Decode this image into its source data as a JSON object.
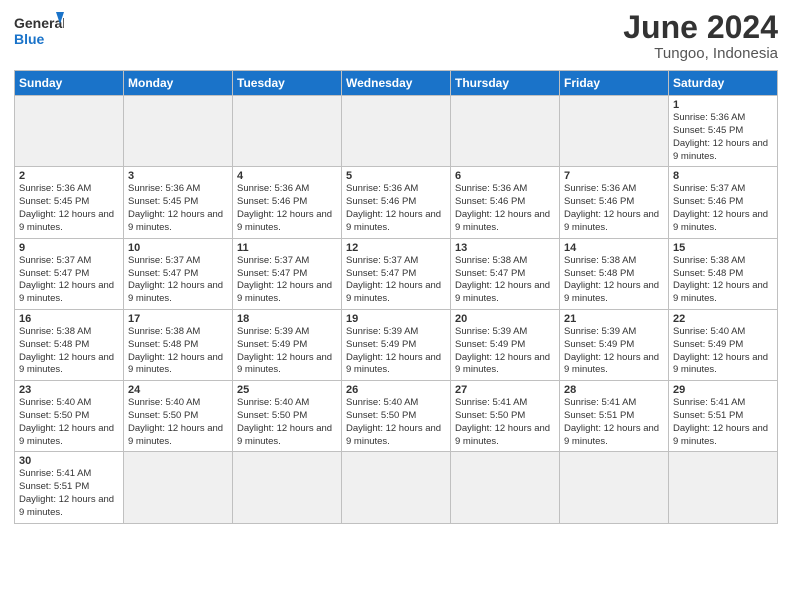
{
  "header": {
    "logo_general": "General",
    "logo_blue": "Blue",
    "title": "June 2024",
    "subtitle": "Tungoo, Indonesia"
  },
  "days_of_week": [
    "Sunday",
    "Monday",
    "Tuesday",
    "Wednesday",
    "Thursday",
    "Friday",
    "Saturday"
  ],
  "weeks": [
    [
      {
        "day": "",
        "info": "",
        "empty": true
      },
      {
        "day": "",
        "info": "",
        "empty": true
      },
      {
        "day": "",
        "info": "",
        "empty": true
      },
      {
        "day": "",
        "info": "",
        "empty": true
      },
      {
        "day": "",
        "info": "",
        "empty": true
      },
      {
        "day": "",
        "info": "",
        "empty": true
      },
      {
        "day": "1",
        "info": "Sunrise: 5:36 AM\nSunset: 5:45 PM\nDaylight: 12 hours and 9 minutes."
      }
    ],
    [
      {
        "day": "2",
        "info": "Sunrise: 5:36 AM\nSunset: 5:45 PM\nDaylight: 12 hours and 9 minutes."
      },
      {
        "day": "3",
        "info": "Sunrise: 5:36 AM\nSunset: 5:45 PM\nDaylight: 12 hours and 9 minutes."
      },
      {
        "day": "4",
        "info": "Sunrise: 5:36 AM\nSunset: 5:46 PM\nDaylight: 12 hours and 9 minutes."
      },
      {
        "day": "5",
        "info": "Sunrise: 5:36 AM\nSunset: 5:46 PM\nDaylight: 12 hours and 9 minutes."
      },
      {
        "day": "6",
        "info": "Sunrise: 5:36 AM\nSunset: 5:46 PM\nDaylight: 12 hours and 9 minutes."
      },
      {
        "day": "7",
        "info": "Sunrise: 5:36 AM\nSunset: 5:46 PM\nDaylight: 12 hours and 9 minutes."
      },
      {
        "day": "8",
        "info": "Sunrise: 5:37 AM\nSunset: 5:46 PM\nDaylight: 12 hours and 9 minutes."
      }
    ],
    [
      {
        "day": "9",
        "info": "Sunrise: 5:37 AM\nSunset: 5:47 PM\nDaylight: 12 hours and 9 minutes."
      },
      {
        "day": "10",
        "info": "Sunrise: 5:37 AM\nSunset: 5:47 PM\nDaylight: 12 hours and 9 minutes."
      },
      {
        "day": "11",
        "info": "Sunrise: 5:37 AM\nSunset: 5:47 PM\nDaylight: 12 hours and 9 minutes."
      },
      {
        "day": "12",
        "info": "Sunrise: 5:37 AM\nSunset: 5:47 PM\nDaylight: 12 hours and 9 minutes."
      },
      {
        "day": "13",
        "info": "Sunrise: 5:38 AM\nSunset: 5:47 PM\nDaylight: 12 hours and 9 minutes."
      },
      {
        "day": "14",
        "info": "Sunrise: 5:38 AM\nSunset: 5:48 PM\nDaylight: 12 hours and 9 minutes."
      },
      {
        "day": "15",
        "info": "Sunrise: 5:38 AM\nSunset: 5:48 PM\nDaylight: 12 hours and 9 minutes."
      }
    ],
    [
      {
        "day": "16",
        "info": "Sunrise: 5:38 AM\nSunset: 5:48 PM\nDaylight: 12 hours and 9 minutes."
      },
      {
        "day": "17",
        "info": "Sunrise: 5:38 AM\nSunset: 5:48 PM\nDaylight: 12 hours and 9 minutes."
      },
      {
        "day": "18",
        "info": "Sunrise: 5:39 AM\nSunset: 5:49 PM\nDaylight: 12 hours and 9 minutes."
      },
      {
        "day": "19",
        "info": "Sunrise: 5:39 AM\nSunset: 5:49 PM\nDaylight: 12 hours and 9 minutes."
      },
      {
        "day": "20",
        "info": "Sunrise: 5:39 AM\nSunset: 5:49 PM\nDaylight: 12 hours and 9 minutes."
      },
      {
        "day": "21",
        "info": "Sunrise: 5:39 AM\nSunset: 5:49 PM\nDaylight: 12 hours and 9 minutes."
      },
      {
        "day": "22",
        "info": "Sunrise: 5:40 AM\nSunset: 5:49 PM\nDaylight: 12 hours and 9 minutes."
      }
    ],
    [
      {
        "day": "23",
        "info": "Sunrise: 5:40 AM\nSunset: 5:50 PM\nDaylight: 12 hours and 9 minutes."
      },
      {
        "day": "24",
        "info": "Sunrise: 5:40 AM\nSunset: 5:50 PM\nDaylight: 12 hours and 9 minutes."
      },
      {
        "day": "25",
        "info": "Sunrise: 5:40 AM\nSunset: 5:50 PM\nDaylight: 12 hours and 9 minutes."
      },
      {
        "day": "26",
        "info": "Sunrise: 5:40 AM\nSunset: 5:50 PM\nDaylight: 12 hours and 9 minutes."
      },
      {
        "day": "27",
        "info": "Sunrise: 5:41 AM\nSunset: 5:50 PM\nDaylight: 12 hours and 9 minutes."
      },
      {
        "day": "28",
        "info": "Sunrise: 5:41 AM\nSunset: 5:51 PM\nDaylight: 12 hours and 9 minutes."
      },
      {
        "day": "29",
        "info": "Sunrise: 5:41 AM\nSunset: 5:51 PM\nDaylight: 12 hours and 9 minutes."
      }
    ],
    [
      {
        "day": "30",
        "info": "Sunrise: 5:41 AM\nSunset: 5:51 PM\nDaylight: 12 hours and 9 minutes."
      },
      {
        "day": "",
        "info": "",
        "empty": true
      },
      {
        "day": "",
        "info": "",
        "empty": true
      },
      {
        "day": "",
        "info": "",
        "empty": true
      },
      {
        "day": "",
        "info": "",
        "empty": true
      },
      {
        "day": "",
        "info": "",
        "empty": true
      },
      {
        "day": "",
        "info": "",
        "empty": true
      }
    ]
  ]
}
